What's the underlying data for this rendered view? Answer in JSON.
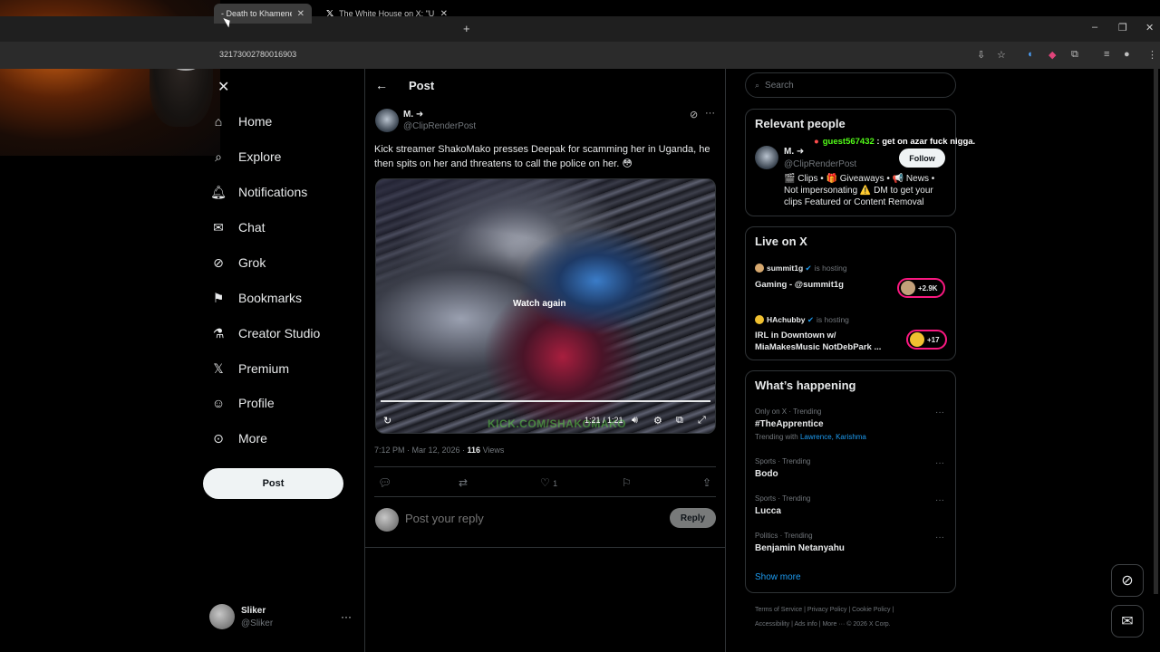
{
  "browser": {
    "tabs": [
      {
        "label": "- Death to Khamenei"
      },
      {
        "label": "The White House on X: \"UNDE"
      }
    ],
    "new_tab": "+",
    "url": "32173002780016903",
    "window_controls": [
      "–",
      "❐",
      "✕"
    ]
  },
  "nav": {
    "back_label": "✕",
    "items": [
      {
        "label": "Home",
        "icon": "home-icon"
      },
      {
        "label": "Explore",
        "icon": "search-icon"
      },
      {
        "label": "Notifications",
        "icon": "bell-icon"
      },
      {
        "label": "Chat",
        "icon": "envelope-icon"
      },
      {
        "label": "Grok",
        "icon": "grok-icon"
      },
      {
        "label": "Bookmarks",
        "icon": "bookmark-icon"
      },
      {
        "label": "Creator Studio",
        "icon": "flask-icon"
      },
      {
        "label": "Premium",
        "icon": "x-logo-icon"
      },
      {
        "label": "Profile",
        "icon": "person-icon"
      },
      {
        "label": "More",
        "icon": "more-circle-icon"
      }
    ],
    "post_button": "Post",
    "account": {
      "name": "Sliker",
      "handle": "@Sliker"
    }
  },
  "main": {
    "header_title": "Post",
    "tweet": {
      "author_name": "M. ➜",
      "author_handle": "@ClipRenderPost",
      "text": "Kick streamer ShakoMako presses Deepak for scamming her in Uganda, he then spits on her and threatens to call the police on her. 😳",
      "video": {
        "overlay_label": "Watch again",
        "time": "1:21 / 1:21",
        "watermark": "KICK.COM/SHAKOMAKO",
        "progress": 1.0
      },
      "timestamp": "7:12 PM · Mar 12, 2026 · ",
      "views_count": "116",
      "views_label": " Views",
      "likes": "1"
    },
    "reply": {
      "placeholder": "Post your reply",
      "button": "Reply"
    }
  },
  "sidebar": {
    "search_placeholder": "Search",
    "relevant_people": {
      "title": "Relevant people",
      "name": "M. ➜",
      "handle": "@ClipRenderPost",
      "follow": "Follow",
      "bio": "🎬 Clips • 🎁 Giveaways • 📢 News • Not impersonating ⚠️ DM to get your clips Featured or Content Removal"
    },
    "chat_overlay": {
      "user": "guest567432",
      "message": " : get on azar fuck nigga."
    },
    "live": {
      "title": "Live on X",
      "items": [
        {
          "host": "summit1g",
          "status": "is hosting",
          "title": "Gaming - @summit1g",
          "count": "+2.9K"
        },
        {
          "host": "HAchubby",
          "status": "is hosting",
          "title": "IRL in Downtown w/ MiaMakesMusic NotDebPark ...",
          "count": "+17"
        }
      ]
    },
    "trends": {
      "title": "What’s happening",
      "items": [
        {
          "meta": "Only on X · Trending",
          "name": "#TheApprentice",
          "with_label": "Trending with ",
          "with_links": "Lawrence, Karishma"
        },
        {
          "meta": "Sports · Trending",
          "name": "Bodo"
        },
        {
          "meta": "Sports · Trending",
          "name": "Lucca"
        },
        {
          "meta": "Politics · Trending",
          "name": "Benjamin Netanyahu"
        }
      ],
      "show_more": "Show more"
    },
    "footer": {
      "line1": "Terms of Service  |  Privacy Policy  |  Cookie Policy  |",
      "line2": "Accessibility  |  Ads info  |  More ···  © 2026 X Corp."
    }
  },
  "colors": {
    "accent": "#1d9bf0",
    "live": "#f91880",
    "kick_green": "#53fc18"
  }
}
